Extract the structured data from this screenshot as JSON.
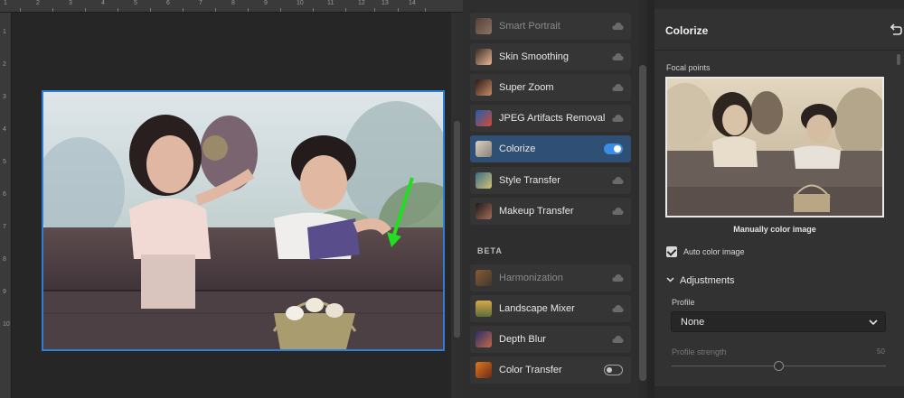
{
  "rulers": {
    "top": [
      "1",
      "2",
      "3",
      "4",
      "5",
      "6",
      "7",
      "8",
      "9",
      "10",
      "11",
      "12",
      "13",
      "14"
    ],
    "left": [
      "1",
      "2",
      "3",
      "4",
      "5",
      "6",
      "7",
      "8",
      "9",
      "10"
    ]
  },
  "filters": [
    {
      "label": "Smart Portrait",
      "state": "cloud",
      "dimmed": true
    },
    {
      "label": "Skin Smoothing",
      "state": "cloud"
    },
    {
      "label": "Super Zoom",
      "state": "cloud"
    },
    {
      "label": "JPEG Artifacts Removal",
      "state": "cloud"
    },
    {
      "label": "Colorize",
      "state": "toggle-on",
      "active": true
    },
    {
      "label": "Style Transfer",
      "state": "cloud"
    },
    {
      "label": "Makeup Transfer",
      "state": "cloud"
    }
  ],
  "beta_label": "BETA",
  "beta_filters": [
    {
      "label": "Harmonization",
      "state": "cloud",
      "dimmed": true
    },
    {
      "label": "Landscape Mixer",
      "state": "cloud"
    },
    {
      "label": "Depth Blur",
      "state": "cloud"
    },
    {
      "label": "Color Transfer",
      "state": "toggle-off"
    }
  ],
  "panel": {
    "title": "Colorize",
    "focal_points_label": "Focal points",
    "manual_color_label": "Manually color image",
    "auto_color": {
      "label": "Auto color image",
      "checked": true
    },
    "adjustments_label": "Adjustments",
    "profile_label": "Profile",
    "profile_value": "None",
    "profile_strength_label": "Profile strength",
    "profile_strength_value": "50",
    "profile_strength_fraction": 0.5
  },
  "colors": {
    "accent": "#3a8ee6",
    "active_row": "#2f4f74",
    "selection_border": "#2f7fd9",
    "arrow": "#22dd22"
  }
}
